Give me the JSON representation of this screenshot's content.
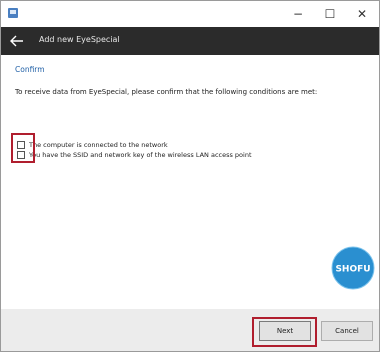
{
  "window": {
    "controls": {
      "minimize": "−",
      "maximize": "☐",
      "close": "✕"
    }
  },
  "navbar": {
    "back_icon": "arrow-left-icon",
    "title": "Add new EyeSpecial"
  },
  "content": {
    "section_title": "Confirm",
    "instruction": "To receive data from EyeSpecial, please confirm that the following conditions are met:",
    "conditions": [
      {
        "label": "The computer is connected to the network",
        "checked": false
      },
      {
        "label": "You have the SSID and network key of the wireless LAN access point",
        "checked": false
      }
    ],
    "logo_text": "SHOFU"
  },
  "footer": {
    "next_label": "Next",
    "cancel_label": "Cancel"
  },
  "colors": {
    "accent_title": "#1f5fa6",
    "navbar_bg": "#2b2b2b",
    "highlight": "#b01e2e",
    "logo_blue": "#2a8fd0"
  }
}
